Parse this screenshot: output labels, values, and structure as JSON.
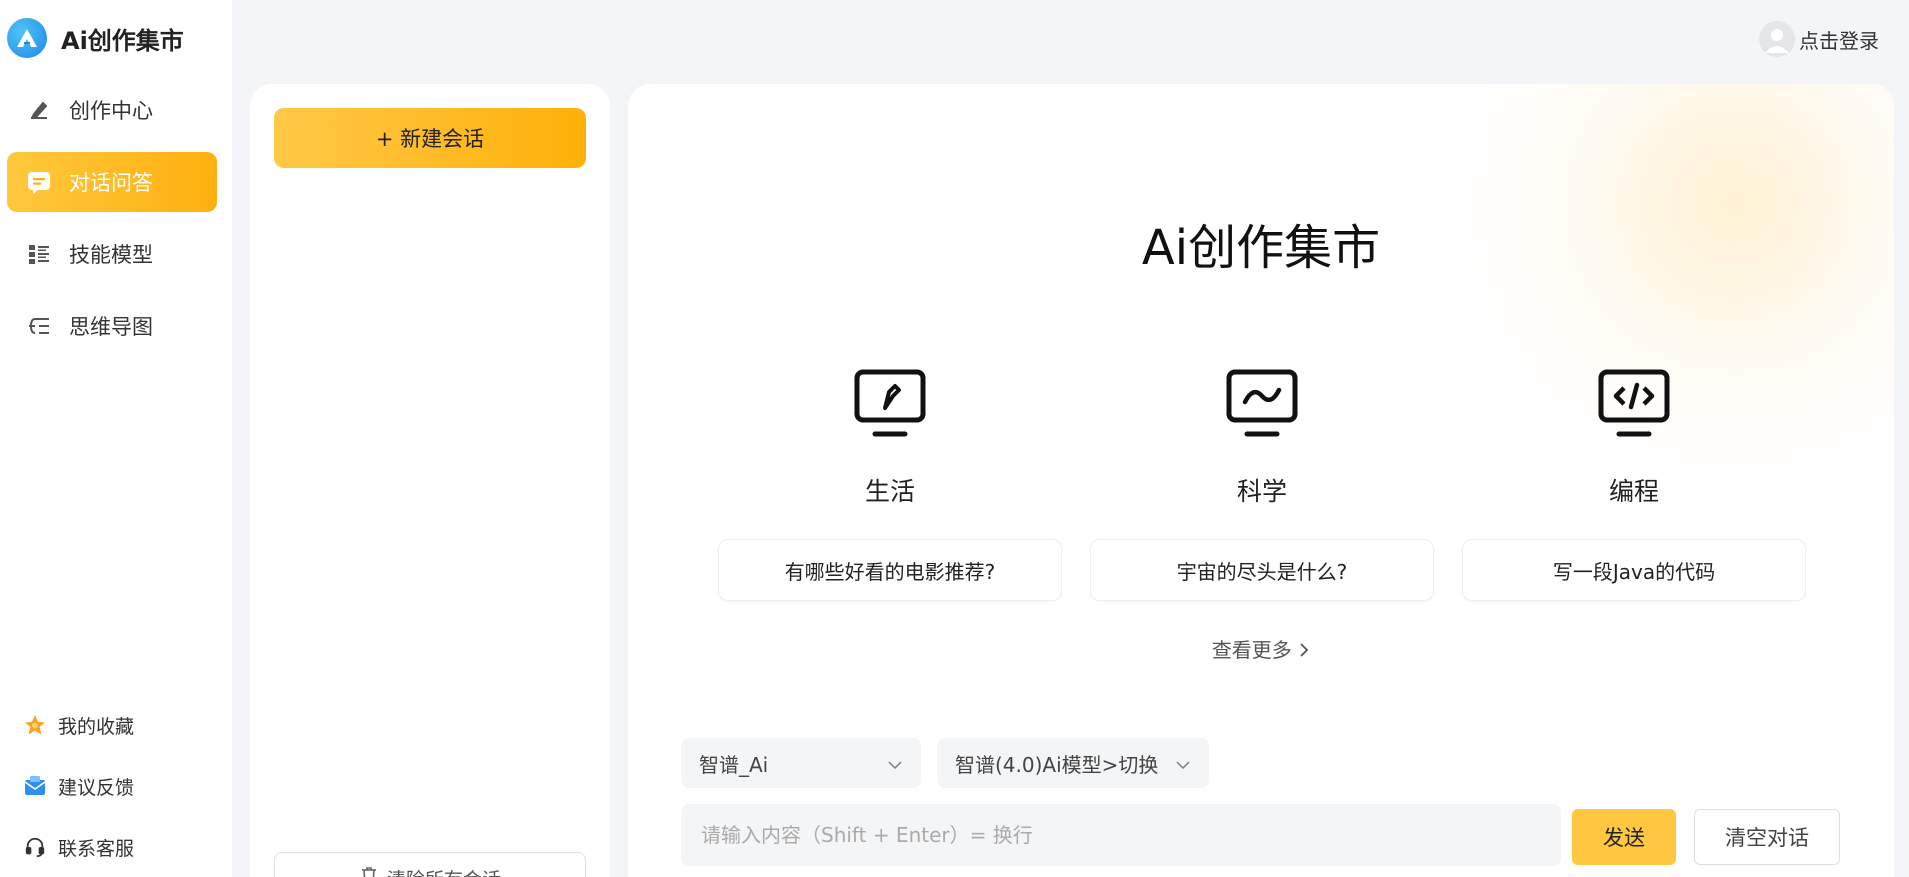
{
  "brand": {
    "name": "Ai创作集市"
  },
  "nav": {
    "items": [
      {
        "label": "创作中心",
        "icon": "pen-icon"
      },
      {
        "label": "对话问答",
        "icon": "chat-icon",
        "active": true
      },
      {
        "label": "技能模型",
        "icon": "list-icon"
      },
      {
        "label": "思维导图",
        "icon": "mindmap-icon"
      }
    ],
    "bottom": [
      {
        "label": "我的收藏",
        "icon": "star-icon"
      },
      {
        "label": "建议反馈",
        "icon": "mail-icon"
      },
      {
        "label": "联系客服",
        "icon": "headset-icon"
      }
    ]
  },
  "sessions": {
    "new_label": "+ 新建会话",
    "clear_all_label": "清除所有会话"
  },
  "header": {
    "login_label": "点击登录"
  },
  "main": {
    "title": "Ai创作集市",
    "categories": [
      {
        "label": "生活",
        "icon": "monitor-pen-icon",
        "prompt": "有哪些好看的电影推荐?"
      },
      {
        "label": "科学",
        "icon": "monitor-chart-icon",
        "prompt": "宇宙的尽头是什么?"
      },
      {
        "label": "编程",
        "icon": "monitor-code-icon",
        "prompt": "写一段Java的代码"
      }
    ],
    "see_more": "查看更多",
    "model_select": "智谱_Ai",
    "version_select": "智谱(4.0)Ai模型>切换",
    "input_placeholder": "请输入内容（Shift + Enter）= 换行",
    "send_label": "发送",
    "clear_label": "清空对话"
  },
  "colors": {
    "accent": "#ffb00f",
    "accent_light": "#ffc83d"
  }
}
